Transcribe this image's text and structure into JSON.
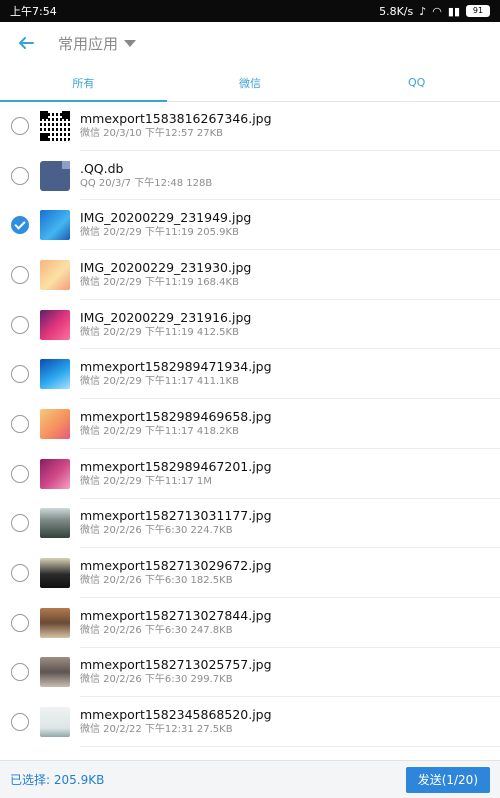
{
  "status": {
    "time": "上午7:54",
    "speed": "5.8K/s",
    "battery": "91"
  },
  "header": {
    "title": "常用应用",
    "back_icon": "arrow-left-icon",
    "dropdown_icon": "caret-down-icon"
  },
  "tabs": [
    {
      "label": "所有",
      "active": true
    },
    {
      "label": "微信",
      "active": false
    },
    {
      "label": "QQ",
      "active": false
    }
  ],
  "files": [
    {
      "name": "mmexport1583816267346.jpg",
      "meta": "微信 20/3/10 下午12:57 27KB",
      "checked": false,
      "thumb": "t-qr"
    },
    {
      "name": ".QQ.db",
      "meta": "QQ 20/3/7 下午12:48 128B",
      "checked": false,
      "thumb": "t-db"
    },
    {
      "name": "IMG_20200229_231949.jpg",
      "meta": "微信 20/2/29 下午11:19 205.9KB",
      "checked": true,
      "thumb": "t-blue"
    },
    {
      "name": "IMG_20200229_231930.jpg",
      "meta": "微信 20/2/29 下午11:19 168.4KB",
      "checked": false,
      "thumb": "t-peach"
    },
    {
      "name": "IMG_20200229_231916.jpg",
      "meta": "微信 20/2/29 下午11:19 412.5KB",
      "checked": false,
      "thumb": "t-magenta"
    },
    {
      "name": "mmexport1582989471934.jpg",
      "meta": "微信 20/2/29 下午11:17 411.1KB",
      "checked": false,
      "thumb": "t-blue2"
    },
    {
      "name": "mmexport1582989469658.jpg",
      "meta": "微信 20/2/29 下午11:17 418.2KB",
      "checked": false,
      "thumb": "t-orange"
    },
    {
      "name": "mmexport1582989467201.jpg",
      "meta": "微信 20/2/29 下午11:17 1M",
      "checked": false,
      "thumb": "t-pink"
    },
    {
      "name": "mmexport1582713031177.jpg",
      "meta": "微信 20/2/26 下午6:30 224.7KB",
      "checked": false,
      "thumb": "t-photo1"
    },
    {
      "name": "mmexport1582713029672.jpg",
      "meta": "微信 20/2/26 下午6:30 182.5KB",
      "checked": false,
      "thumb": "t-photo2"
    },
    {
      "name": "mmexport1582713027844.jpg",
      "meta": "微信 20/2/26 下午6:30 247.8KB",
      "checked": false,
      "thumb": "t-photo3"
    },
    {
      "name": "mmexport1582713025757.jpg",
      "meta": "微信 20/2/26 下午6:30 299.7KB",
      "checked": false,
      "thumb": "t-photo4"
    },
    {
      "name": "mmexport1582345868520.jpg",
      "meta": "微信 20/2/22 下午12:31 27.5KB",
      "checked": false,
      "thumb": "t-photo5"
    }
  ],
  "footer": {
    "selected_label": "已选择: 205.9KB",
    "send_label": "发送(1/20)"
  },
  "colors": {
    "accent": "#3aa3d6",
    "checked": "#2f8fde",
    "button": "#2d86d9"
  }
}
